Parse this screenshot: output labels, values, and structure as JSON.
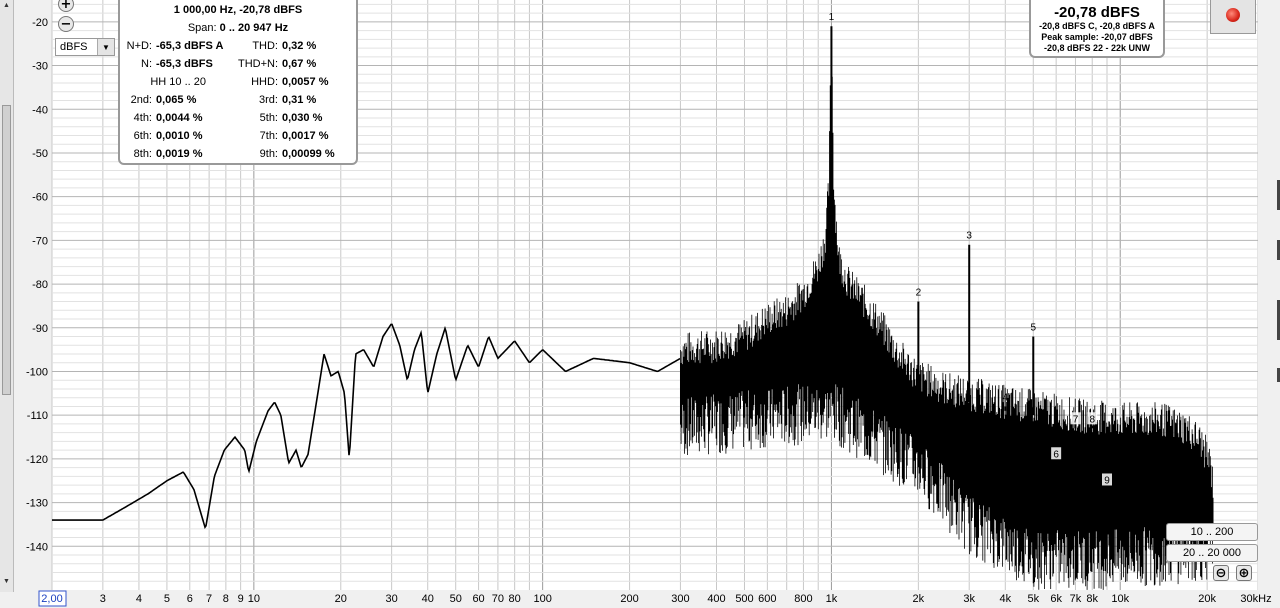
{
  "chart_data": {
    "type": "line",
    "x_scale": "log",
    "xlim": [
      2,
      30000
    ],
    "ylim": [
      -150,
      -15
    ],
    "y_ticks": [
      -20,
      -30,
      -40,
      -50,
      -60,
      -70,
      -80,
      -90,
      -100,
      -110,
      -120,
      -130,
      -140
    ],
    "x_tick_labels": [
      {
        "x": 3,
        "label": "3"
      },
      {
        "x": 4,
        "label": "4"
      },
      {
        "x": 5,
        "label": "5"
      },
      {
        "x": 6,
        "label": "6"
      },
      {
        "x": 7,
        "label": "7"
      },
      {
        "x": 8,
        "label": "8"
      },
      {
        "x": 9,
        "label": "9"
      },
      {
        "x": 10,
        "label": "10"
      },
      {
        "x": 20,
        "label": "20"
      },
      {
        "x": 30,
        "label": "30"
      },
      {
        "x": 40,
        "label": "40"
      },
      {
        "x": 50,
        "label": "50"
      },
      {
        "x": 60,
        "label": "60"
      },
      {
        "x": 70,
        "label": "70"
      },
      {
        "x": 80,
        "label": "80"
      },
      {
        "x": 100,
        "label": "100"
      },
      {
        "x": 200,
        "label": "200"
      },
      {
        "x": 300,
        "label": "300"
      },
      {
        "x": 400,
        "label": "400"
      },
      {
        "x": 500,
        "label": "500"
      },
      {
        "x": 600,
        "label": "600"
      },
      {
        "x": 800,
        "label": "800"
      },
      {
        "x": 1000,
        "label": "1k"
      },
      {
        "x": 2000,
        "label": "2k"
      },
      {
        "x": 3000,
        "label": "3k"
      },
      {
        "x": 4000,
        "label": "4k"
      },
      {
        "x": 5000,
        "label": "5k"
      },
      {
        "x": 6000,
        "label": "6k"
      },
      {
        "x": 7000,
        "label": "7k"
      },
      {
        "x": 8000,
        "label": "8k"
      },
      {
        "x": 10000,
        "label": "10k"
      },
      {
        "x": 20000,
        "label": "20k"
      },
      {
        "x": 30000,
        "label": "30kHz"
      }
    ],
    "x_start_label": "2,00",
    "spectrum": [
      [
        2,
        -134
      ],
      [
        3,
        -134
      ],
      [
        3.6,
        -131
      ],
      [
        4.3,
        -128
      ],
      [
        5,
        -125
      ],
      [
        5.7,
        -123
      ],
      [
        6.2,
        -127
      ],
      [
        6.8,
        -136
      ],
      [
        7.3,
        -124
      ],
      [
        7.9,
        -118
      ],
      [
        8.6,
        -115
      ],
      [
        9.3,
        -118
      ],
      [
        9.6,
        -123
      ],
      [
        10.2,
        -116
      ],
      [
        11.2,
        -109
      ],
      [
        11.8,
        -107
      ],
      [
        12.4,
        -110
      ],
      [
        13.2,
        -121
      ],
      [
        14,
        -118
      ],
      [
        14.6,
        -122
      ],
      [
        15.4,
        -119
      ],
      [
        16.2,
        -110
      ],
      [
        17.5,
        -96
      ],
      [
        18.5,
        -101
      ],
      [
        19.6,
        -100
      ],
      [
        20.6,
        -105
      ],
      [
        21.4,
        -120
      ],
      [
        22.5,
        -96
      ],
      [
        24,
        -95
      ],
      [
        26,
        -99
      ],
      [
        28,
        -92
      ],
      [
        30,
        -89
      ],
      [
        32,
        -94
      ],
      [
        34,
        -102
      ],
      [
        36,
        -95
      ],
      [
        38,
        -91
      ],
      [
        40,
        -105
      ],
      [
        43,
        -96
      ],
      [
        46,
        -90
      ],
      [
        50,
        -102
      ],
      [
        55,
        -94
      ],
      [
        60,
        -99
      ],
      [
        65,
        -92
      ],
      [
        70,
        -97
      ],
      [
        80,
        -93
      ],
      [
        90,
        -98
      ],
      [
        100,
        -95
      ],
      [
        120,
        -100
      ],
      [
        150,
        -97
      ],
      [
        200,
        -98
      ],
      [
        250,
        -100
      ],
      [
        300,
        -97
      ],
      [
        400,
        -96
      ],
      [
        500,
        -94
      ],
      [
        600,
        -90
      ],
      [
        700,
        -88
      ],
      [
        800,
        -84
      ],
      [
        900,
        -78
      ],
      [
        950,
        -72
      ],
      [
        980,
        -60
      ],
      [
        1000,
        -21
      ],
      [
        1020,
        -60
      ],
      [
        1060,
        -76
      ],
      [
        1150,
        -82
      ],
      [
        1300,
        -86
      ],
      [
        1500,
        -92
      ],
      [
        1700,
        -98
      ],
      [
        2000,
        -103
      ],
      [
        2500,
        -106
      ],
      [
        3000,
        -107
      ],
      [
        4000,
        -109
      ],
      [
        5000,
        -110
      ],
      [
        7000,
        -112
      ],
      [
        10000,
        -113
      ],
      [
        14000,
        -113
      ],
      [
        17000,
        -115
      ],
      [
        19000,
        -118
      ],
      [
        20500,
        -123
      ],
      [
        21000,
        -128
      ]
    ],
    "noise_band": {
      "start_hz": 300,
      "end_hz": 21000,
      "lower_edge": [
        [
          300,
          -116
        ],
        [
          1000,
          -112
        ],
        [
          2000,
          -125
        ],
        [
          3000,
          -138
        ],
        [
          5000,
          -146
        ],
        [
          10000,
          -146
        ],
        [
          20000,
          -144
        ]
      ]
    },
    "harmonics": [
      {
        "label": "1",
        "hz": 1000,
        "db": -21
      },
      {
        "label": "2",
        "hz": 2000,
        "db": -84
      },
      {
        "label": "3",
        "hz": 3000,
        "db": -71
      },
      {
        "label": "4",
        "hz": 4000,
        "db": -108
      },
      {
        "label": "5",
        "hz": 5000,
        "db": -92
      },
      {
        "label": "6",
        "hz": 6000,
        "db": -121
      },
      {
        "label": "7",
        "hz": 7000,
        "db": -113
      },
      {
        "label": "8",
        "hz": 8000,
        "db": -113
      },
      {
        "label": "9",
        "hz": 9000,
        "db": -127
      }
    ]
  },
  "controls": {
    "unit": "dBFS",
    "plus_icon": "+",
    "minus_icon": "−",
    "zoom_minus_icon": "⊖",
    "zoom_plus_icon": "⊕",
    "range_10_200": "10 .. 200",
    "range_20_20000": "20 .. 20 000"
  },
  "info": {
    "title": "1 000,00 Hz, -20,78 dBFS",
    "span_label": "Span:",
    "span_value": "0 .. 20 947 Hz",
    "rows": [
      {
        "l1": "N+D:",
        "v1": "-65,3 dBFS A",
        "l2": "THD:",
        "v2": "0,32 %"
      },
      {
        "l1": "N:",
        "v1": "-65,3 dBFS",
        "l2": "THD+N:",
        "v2": "0,67 %"
      },
      {
        "l1": "HH 10 .. 20",
        "v1": "",
        "l2": "HHD:",
        "v2": "0,0057 %"
      },
      {
        "l1": "2nd:",
        "v1": "0,065 %",
        "l2": "3rd:",
        "v2": "0,31 %"
      },
      {
        "l1": "4th:",
        "v1": "0,0044 %",
        "l2": "5th:",
        "v2": "0,030 %"
      },
      {
        "l1": "6th:",
        "v1": "0,0010 %",
        "l2": "7th:",
        "v2": "0,0017 %"
      },
      {
        "l1": "8th:",
        "v1": "0,0019 %",
        "l2": "9th:",
        "v2": "0,00099 %"
      }
    ]
  },
  "level": {
    "value": "-20,78 dBFS",
    "line1": "-20,8 dBFS C, -20,8 dBFS A",
    "line2": "Peak sample: -20,07 dBFS",
    "line3": "-20,8 dBFS 22 - 22k UNW"
  },
  "colors": {
    "background": "#ffffff",
    "grid": "#c8c8c8",
    "grid_major": "#9a9a9a",
    "trace": "#000000",
    "record": "#d8261a"
  }
}
